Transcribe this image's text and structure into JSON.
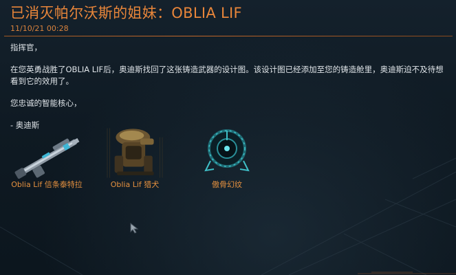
{
  "inbox_message": {
    "title": "已消灭帕尔沃斯的姐妹：OBLIA LIF",
    "timestamp": "11/10/21 00:28"
  },
  "message_body": {
    "greeting": "指挥官，",
    "paragraph": "在您英勇战胜了OBLIA LIF后，奥迪斯找回了这张铸造武器的设计图。该设计图已经添加至您的铸造舱里，奥迪斯迫不及待想看到它的效用了。",
    "closing": "您忠诚的智能核心，",
    "signature": "- 奥迪斯"
  },
  "rewards": [
    {
      "label": "Oblia Lif 信条泰特拉",
      "icon": "rifle-icon"
    },
    {
      "label": "Oblia Lif 猎犬",
      "icon": "hound-icon"
    },
    {
      "label": "傲骨幻纹",
      "icon": "glyph-sigil-icon"
    }
  ],
  "colors": {
    "accent": "#e9863a",
    "text": "#dfe4e8",
    "background": "#0f1b25"
  }
}
